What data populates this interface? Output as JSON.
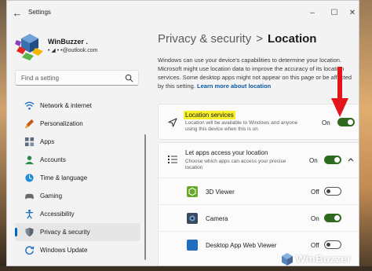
{
  "window": {
    "title": "Settings",
    "back_icon": "back-arrow-icon",
    "controls": {
      "minimize_icon": "minimize-icon",
      "maximize_icon": "maximize-icon",
      "close_icon": "close-icon"
    }
  },
  "account": {
    "name": "WinBuzzer .",
    "email": "• ◢ •   •@outlook.com"
  },
  "search": {
    "placeholder": "Find a setting"
  },
  "sidebar": {
    "items": [
      {
        "label": "Network & internet",
        "icon": "wifi-icon"
      },
      {
        "label": "Personalization",
        "icon": "brush-icon"
      },
      {
        "label": "Apps",
        "icon": "apps-icon"
      },
      {
        "label": "Accounts",
        "icon": "person-icon"
      },
      {
        "label": "Time & language",
        "icon": "clock-globe-icon"
      },
      {
        "label": "Gaming",
        "icon": "controller-icon"
      },
      {
        "label": "Accessibility",
        "icon": "accessibility-icon"
      },
      {
        "label": "Privacy & security",
        "icon": "shield-icon",
        "selected": true
      },
      {
        "label": "Windows Update",
        "icon": "update-icon"
      }
    ]
  },
  "breadcrumb": {
    "parent": "Privacy & security",
    "separator": ">",
    "current": "Location"
  },
  "description": {
    "text": "Windows can use your device's capabilities to determine your location. Microsoft might use location data to improve the accuracy of its location services. Some desktop apps might not appear on this page or be affected by this setting.",
    "link": "Learn more about location"
  },
  "location_services": {
    "title": "Location services",
    "subtitle": "Location will be available to Windows and anyone using this device when this is on",
    "state": "On",
    "icon": "location-arrow-icon"
  },
  "app_access": {
    "title": "Let apps access your location",
    "subtitle": "Choose which apps can access your precise location",
    "state": "On",
    "icon": "list-icon",
    "collapse_icon": "chevron-up-icon"
  },
  "apps": [
    {
      "name": "3D Viewer",
      "state": "Off",
      "icon": "3d-viewer-icon"
    },
    {
      "name": "Camera",
      "state": "On",
      "icon": "camera-icon"
    },
    {
      "name": "Desktop App Web Viewer",
      "state": "Off",
      "icon": "web-viewer-icon"
    }
  ],
  "watermark": {
    "text": "WinBuzzer"
  },
  "colors": {
    "accent": "#0067c0",
    "toggle_on": "#2e6a1f",
    "highlight": "#f6ef2a",
    "arrow": "#e3141b"
  }
}
